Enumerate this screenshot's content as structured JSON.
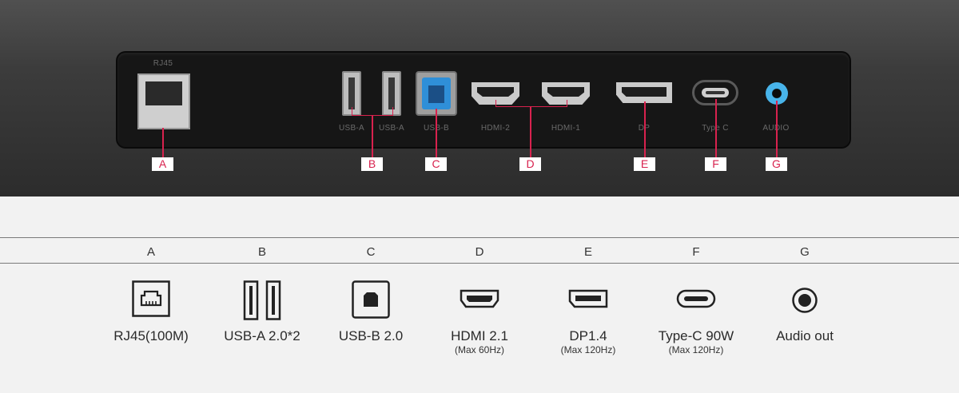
{
  "panel_labels": {
    "rj45": "RJ45",
    "usba1": "USB-A",
    "usba2": "USB-A",
    "usbb": "USB-B",
    "hdmi2": "HDMI-2",
    "hdmi1": "HDMI-1",
    "dp": "DP",
    "typec": "Type C",
    "audio": "AUDIO"
  },
  "callout_letters": [
    "A",
    "B",
    "C",
    "D",
    "E",
    "F",
    "G"
  ],
  "legend": [
    {
      "letter": "A",
      "name": "RJ45(100M)",
      "sub": "",
      "icon": "ethernet-icon"
    },
    {
      "letter": "B",
      "name": "USB-A 2.0*2",
      "sub": "",
      "icon": "usb-a-icon"
    },
    {
      "letter": "C",
      "name": "USB-B 2.0",
      "sub": "",
      "icon": "usb-b-icon"
    },
    {
      "letter": "D",
      "name": "HDMI 2.1",
      "sub": "(Max 60Hz)",
      "icon": "hdmi-icon"
    },
    {
      "letter": "E",
      "name": "DP1.4",
      "sub": "(Max 120Hz)",
      "icon": "displayport-icon"
    },
    {
      "letter": "F",
      "name": "Type-C 90W",
      "sub": "(Max 120Hz)",
      "icon": "usb-c-icon"
    },
    {
      "letter": "G",
      "name": "Audio out",
      "sub": "",
      "icon": "audio-jack-icon"
    }
  ],
  "colors": {
    "accent": "#d8224e",
    "usb_b": "#2f8fd8",
    "audio": "#48b4ea"
  }
}
